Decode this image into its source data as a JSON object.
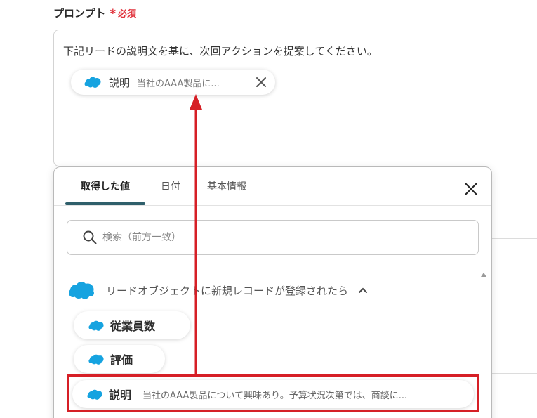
{
  "prompt_field": {
    "label": "プロンプト",
    "required_mark": "*",
    "required_text": "必須",
    "text": "下記リードの説明文を基に、次回アクションを提案してください。",
    "inserted_variable": {
      "name": "説明",
      "value": "当社のAAA製品に...",
      "icon": "salesforce-cloud-icon",
      "remove_icon": "close-icon"
    }
  },
  "picker": {
    "tabs": [
      {
        "label": "取得した値",
        "active": true
      },
      {
        "label": "日付",
        "active": false
      },
      {
        "label": "基本情報",
        "active": false
      }
    ],
    "close_icon": "close-icon",
    "search": {
      "placeholder": "検索（前方一致）",
      "icon": "search-icon"
    },
    "group": {
      "title": "リードオブジェクトに新規レコードが登録されたら",
      "expanded": true,
      "icon": "salesforce-cloud-icon",
      "toggle_icon": "chevron-up-icon"
    },
    "options": [
      {
        "name": "従業員数",
        "value": ""
      },
      {
        "name": "評価",
        "value": ""
      },
      {
        "name": "説明",
        "value": "当社のAAA製品について興味あり。予算状況次第では、商談に..."
      }
    ]
  },
  "annotation": {
    "arrow_color": "#d61f26",
    "highlighted_option": "説明"
  },
  "colors": {
    "accent_tab": "#2f5f6b",
    "required": "#e0313b",
    "salesforce": "#16a3e0",
    "annotation": "#d61f26"
  }
}
